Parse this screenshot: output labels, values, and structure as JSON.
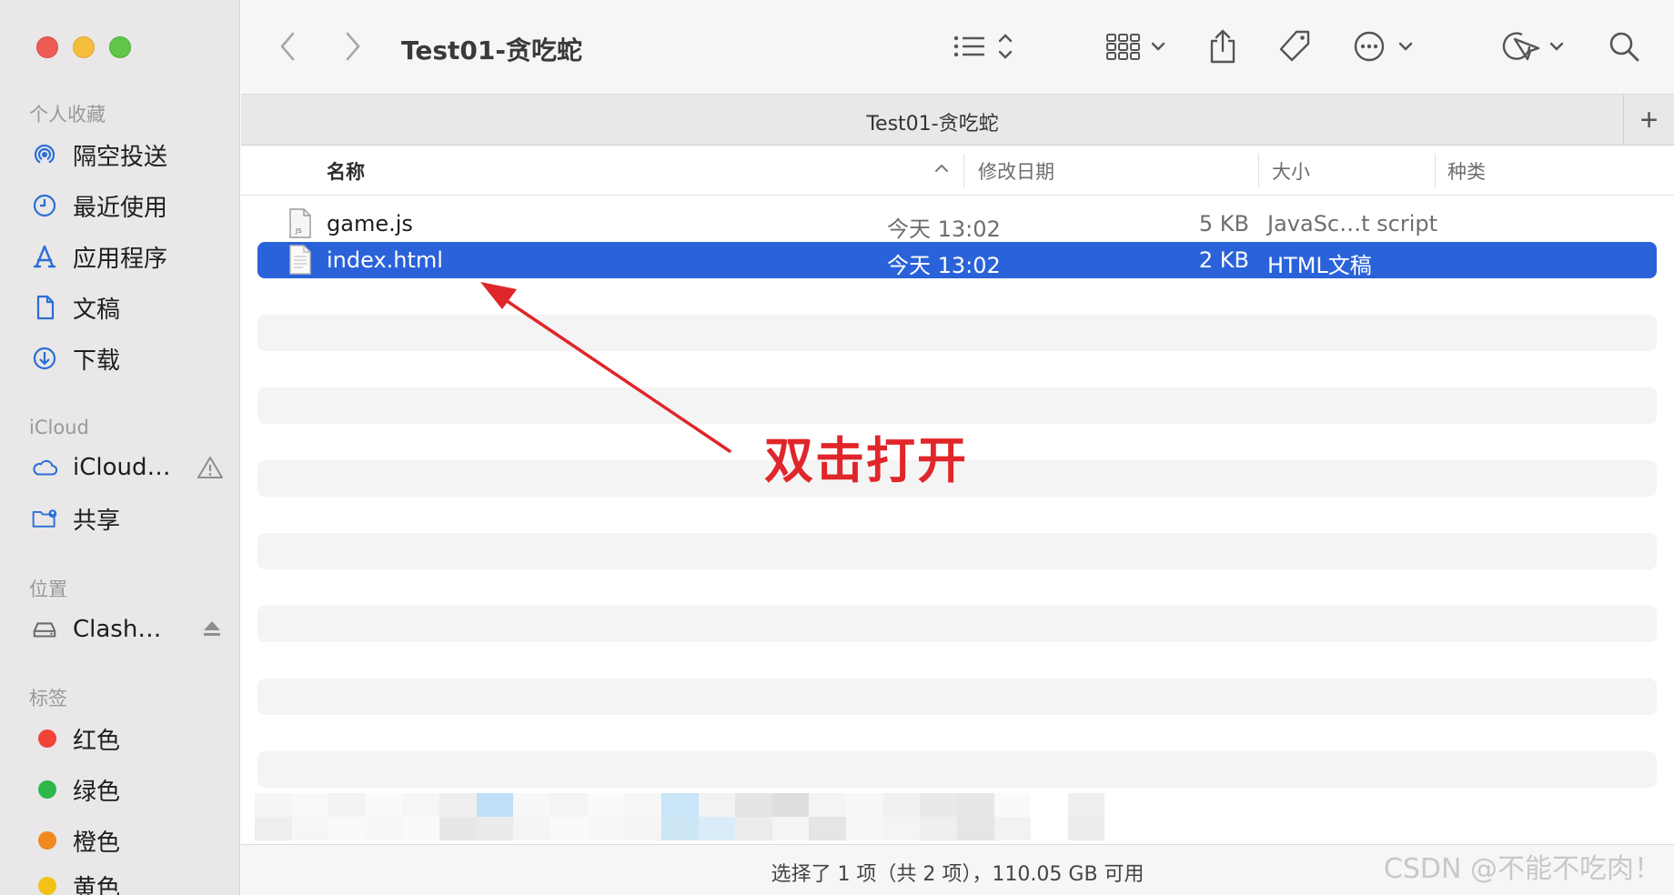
{
  "window": {
    "title": "Test01-贪吃蛇"
  },
  "sidebar": {
    "favorites_header": "个人收藏",
    "favorites": [
      {
        "label": "隔空投送",
        "icon": "airdrop-icon"
      },
      {
        "label": "最近使用",
        "icon": "clock-icon"
      },
      {
        "label": "应用程序",
        "icon": "applications-icon"
      },
      {
        "label": "文稿",
        "icon": "document-icon"
      },
      {
        "label": "下载",
        "icon": "download-icon"
      }
    ],
    "icloud_header": "iCloud",
    "icloud": [
      {
        "label": "iCloud…",
        "icon": "cloud-icon",
        "tail_icon": "warning-icon"
      },
      {
        "label": "共享",
        "icon": "shared-folder-icon"
      }
    ],
    "locations_header": "位置",
    "locations": [
      {
        "label": "Clash…",
        "icon": "drive-icon",
        "tail_icon": "eject-icon"
      }
    ],
    "tags_header": "标签",
    "tags": [
      {
        "label": "红色",
        "color": "#f04438"
      },
      {
        "label": "绿色",
        "color": "#2fb84a"
      },
      {
        "label": "橙色",
        "color": "#f08a1c"
      },
      {
        "label": "黄色",
        "color": "#f2c316"
      }
    ]
  },
  "tabbar": {
    "title": "Test01-贪吃蛇",
    "add_label": "+"
  },
  "columns": {
    "name": "名称",
    "date": "修改日期",
    "size": "大小",
    "kind": "种类"
  },
  "files": [
    {
      "name": "game.js",
      "date": "今天 13:02",
      "size": "5 KB",
      "kind": "JavaSc…t script",
      "selected": false
    },
    {
      "name": "index.html",
      "date": "今天 13:02",
      "size": "2 KB",
      "kind": "HTML文稿",
      "selected": true
    }
  ],
  "status": {
    "text": "选择了 1 项（共 2 项），110.05 GB 可用"
  },
  "annotation": {
    "text": "双击打开",
    "color": "#e0262a"
  },
  "watermark": "CSDN @不能不吃肉！",
  "colors": {
    "selection": "#2a62d9",
    "sidebar_bg": "#e9e7e8"
  }
}
